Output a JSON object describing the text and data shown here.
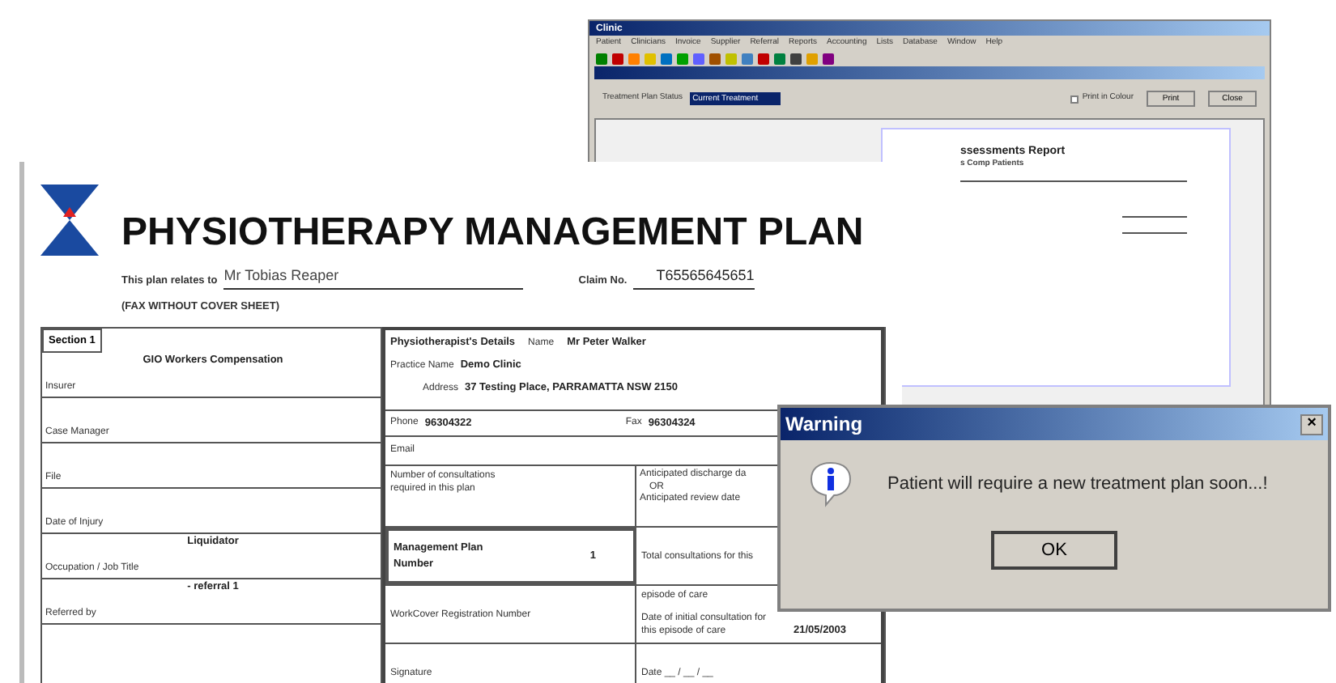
{
  "back_window": {
    "title": "Clinic",
    "menu": [
      "Patient",
      "Clinicians",
      "Invoice",
      "Supplier",
      "Referral",
      "Reports",
      "Accounting",
      "Lists",
      "Database",
      "Window",
      "Help"
    ],
    "controls": {
      "status_label": "Treatment Plan Status",
      "status_value": "Current Treatment",
      "colour_checkbox": {
        "label": "Print in Colour",
        "checked": false
      },
      "buttons": [
        "Print",
        "Close"
      ]
    },
    "report": {
      "title": "ssessments Report",
      "subtitle": "s Comp Patients"
    }
  },
  "form": {
    "title": "PHYSIOTHERAPY MANAGEMENT PLAN",
    "relates_label": "This plan relates to",
    "patient": "Mr Tobias Reaper",
    "claim_label": "Claim No.",
    "claim_no": "T65565645651",
    "fax_note": "(FAX WITHOUT COVER SHEET)",
    "section": "Section 1",
    "left_rows": [
      {
        "label": "Insurer",
        "value": "GIO Workers Compensation"
      },
      {
        "label": "Case Manager"
      },
      {
        "label": "File"
      },
      {
        "label": "Date of Injury"
      },
      {
        "label": "Occupation / Job Title",
        "value": "Liquidator"
      },
      {
        "label": "Referred by",
        "value": "- referral 1"
      }
    ],
    "physio": {
      "heading": "Physiotherapist's Details",
      "name_label": "Name",
      "name": "Mr Peter Walker",
      "practice_label": "Practice Name",
      "practice": "Demo Clinic",
      "address_label": "Address",
      "address": "37 Testing Place, PARRAMATTA NSW 2150",
      "phone_label": "Phone",
      "phone": "96304322",
      "fax_label": "Fax",
      "fax": "96304324",
      "email_label": "Email"
    },
    "consultations_label": "Number of consultations required in this plan",
    "discharge_label": "Anticipated discharge da",
    "or_label": "OR",
    "review_label": "Anticipated review date",
    "plan_number_label": "Management Plan Number",
    "plan_number": "1",
    "total_label": "Total consultations for this episode of care",
    "registration_label": "WorkCover Registration Number",
    "initial_label": "Date of initial consultation for this episode of care",
    "initial_date": "21/05/2003",
    "signature_label": "Signature",
    "date_label": "Date __ / __ / __"
  },
  "dialog": {
    "title": "Warning",
    "close": "×",
    "message": "Patient will require a new treatment plan soon...!",
    "button": "OK"
  }
}
